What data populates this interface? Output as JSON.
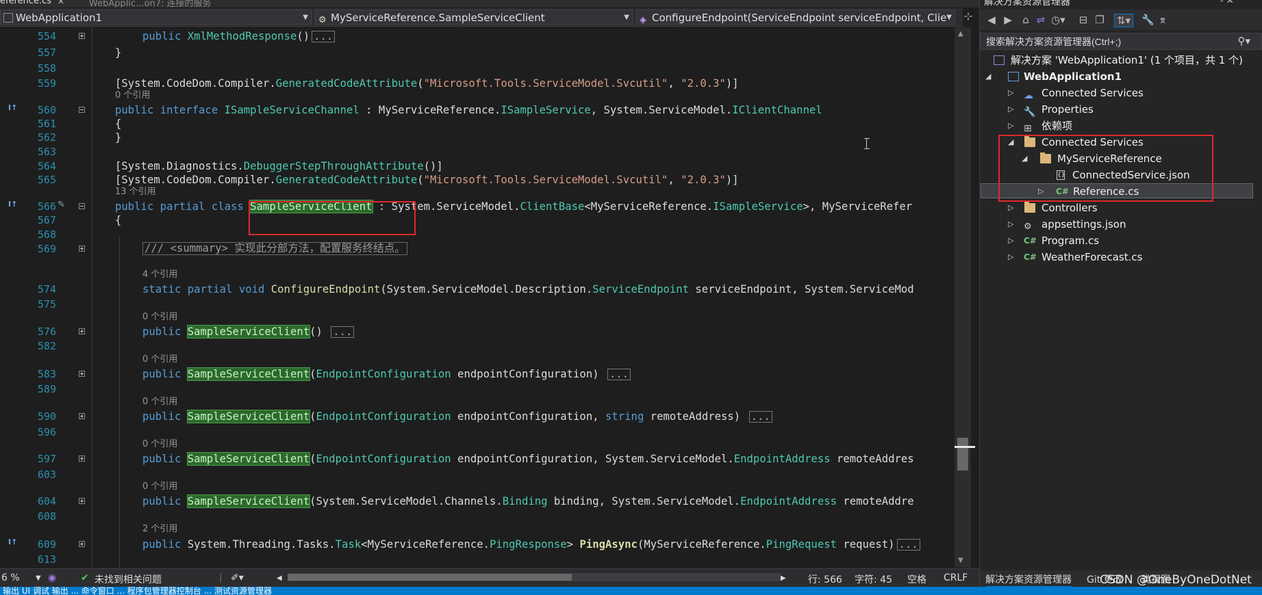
{
  "tabs": [
    {
      "label": "eference.cs",
      "active": true
    },
    {
      "label": "WebApplic...on7: 连接的服务",
      "active": false
    }
  ],
  "nav": {
    "project": "WebApplication1",
    "type": "MyServiceReference.SampleServiceClient",
    "member": "ConfigureEndpoint(ServiceEndpoint serviceEndpoint, Clie"
  },
  "editor": {
    "lines": [
      {
        "n": "554",
        "refs": ""
      },
      {
        "n": "557"
      },
      {
        "n": "558"
      },
      {
        "n": "559"
      },
      {
        "n": "560"
      },
      {
        "n": "561"
      },
      {
        "n": "562"
      },
      {
        "n": "563"
      },
      {
        "n": "564"
      },
      {
        "n": "565"
      },
      {
        "n": "566"
      },
      {
        "n": "567"
      },
      {
        "n": "568"
      },
      {
        "n": "569"
      },
      {
        "n": "574"
      },
      {
        "n": "575"
      },
      {
        "n": "576"
      },
      {
        "n": "582"
      },
      {
        "n": "583"
      },
      {
        "n": "589"
      },
      {
        "n": "590"
      },
      {
        "n": "596"
      },
      {
        "n": "597"
      },
      {
        "n": "603"
      },
      {
        "n": "604"
      },
      {
        "n": "608"
      },
      {
        "n": "609"
      },
      {
        "n": "613"
      }
    ],
    "refs": {
      "r560": "0 个引用",
      "r566": "13 个引用",
      "r574": "4 个引用",
      "r576": "0 个引用",
      "r583": "0 个引用",
      "r590": "0 个引用",
      "r597": "0 个引用",
      "r604": "0 个引用",
      "r609": "2 个引用"
    },
    "code": {
      "l554_kw": "public",
      "l554_ty": "XmlMethodResponse",
      "l554_rest": "()",
      "l557": "}",
      "l559_a": "[System.CodeDom.Compiler.",
      "l559_ty": "GeneratedCodeAttribute",
      "l559_b": "(",
      "l559_s1": "\"Microsoft.Tools.ServiceModel.Svcutil\"",
      "l559_c": ", ",
      "l559_s2": "\"2.0.3\"",
      "l559_d": ")]",
      "l560_kw": "public interface",
      "l560_ty": "ISampleServiceChannel",
      "l560_a": " : MyServiceReference.",
      "l560_ty2": "ISampleService",
      "l560_b": ", System.ServiceModel.",
      "l560_ty3": "IClientChannel",
      "l561": "{",
      "l562": "}",
      "l564_a": "[System.Diagnostics.",
      "l564_ty": "DebuggerStepThroughAttribute",
      "l564_b": "()]",
      "l566_kw": "public partial class",
      "l566_hl": "SampleServiceClient",
      "l566_a": " : System.ServiceModel.",
      "l566_ty": "ClientBase",
      "l566_b": "<MyServiceReference.",
      "l566_ty2": "ISampleService",
      "l566_c": ">, MyServiceRefer",
      "l567": "{",
      "l569": "/// <summary> 实现此分部方法，配置服务终结点。",
      "l574_kw": "static partial void",
      "l574_mt": "ConfigureEndpoint",
      "l574_a": "(System.ServiceModel.Description.",
      "l574_ty": "ServiceEndpoint",
      "l574_b": " serviceEndpoint, System.ServiceMod",
      "ctor_kw": "public",
      "ctor_name": "SampleServiceClient",
      "l576_a": "()",
      "l583_a": "(",
      "l583_ty": "EndpointConfiguration",
      "l583_b": " endpointConfiguration)",
      "l590_b": " endpointConfiguration, ",
      "l590_kw": "string",
      "l590_c": " remoteAddress)",
      "l597_b": " endpointConfiguration, System.ServiceModel.",
      "l597_ty2": "EndpointAddress",
      "l597_c": " remoteAddres",
      "l604_a": "(System.ServiceModel.Channels.",
      "l604_ty": "Binding",
      "l604_b": " binding, System.ServiceModel.",
      "l604_ty2": "EndpointAddress",
      "l604_c": " remoteAddre",
      "l609_kw": "public",
      "l609_a": " System.Threading.Tasks.",
      "l609_ty": "Task",
      "l609_b": "<MyServiceReference.",
      "l609_ty2": "PingResponse",
      "l609_c": "> ",
      "l609_mt": "PingAsync",
      "l609_d": "(MyServiceReference.",
      "l609_ty3": "PingRequest",
      "l609_e": " request)",
      "ellipsis": "..."
    }
  },
  "status": {
    "zoom": "6 %",
    "issues": "未找到相关问题",
    "line": "行: 566",
    "col": "字符: 45",
    "spaces": "空格",
    "eol": "CRLF"
  },
  "bottom_strip": "输出 UI 调试  输出  ...  命令窗口  ...  程序包管理器控制台  ...  测试资源管理器",
  "solution_explorer": {
    "title": "解决方案资源管理器",
    "search_placeholder": "搜索解决方案资源管理器(Ctrl+;)",
    "tree": {
      "solution": "解决方案 'WebApplication1' (1 个项目，共 1 个)",
      "project": "WebApplication1",
      "connected_services_1": "Connected Services",
      "properties": "Properties",
      "dependencies": "依赖项",
      "connected_services_2": "Connected Services",
      "my_service_reference": "MyServiceReference",
      "connected_service_json": "ConnectedService.json",
      "reference_cs": "Reference.cs",
      "controllers": "Controllers",
      "appsettings": "appsettings.json",
      "program": "Program.cs",
      "weather": "WeatherForecast.cs",
      "cs_badge": "C#"
    },
    "bottom_tabs": [
      "解决方案资源管理器",
      "Git 更改",
      "类视图"
    ]
  },
  "watermark": "CSDN @OneByOneDotNet",
  "colors": {
    "keyword": "#569cd6",
    "type": "#4ec9b0",
    "string": "#d69d85",
    "highlight": "#2b6a2b",
    "annotation_box": "#e02828",
    "line_number": "#2b91af"
  }
}
